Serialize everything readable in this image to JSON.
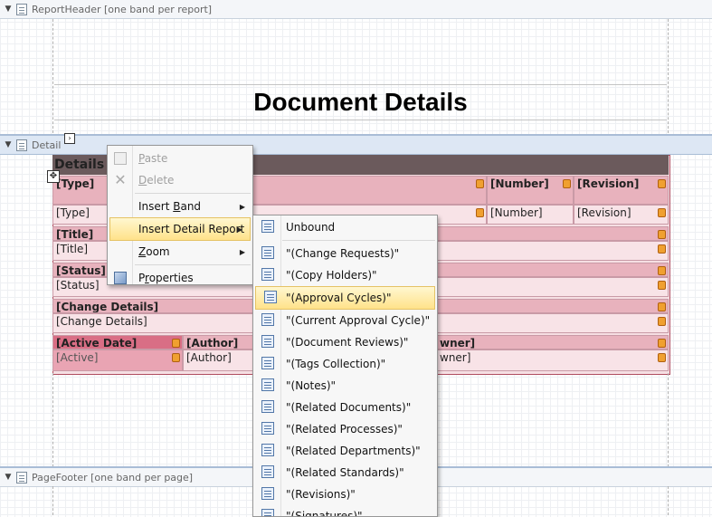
{
  "bands": {
    "report_header": "ReportHeader [one band per report]",
    "detail": "Detail",
    "page_footer": "PageFooter [one band per page]"
  },
  "title": "Document Details",
  "detail": {
    "section_title": "Details",
    "rows": [
      {
        "type_hdr": "[Type]",
        "number_hdr": "[Number]",
        "revision_hdr": "[Revision]"
      },
      {
        "type_val": "[Type]",
        "number_val": "[Number]",
        "revision_val": "[Revision]"
      }
    ],
    "title_hdr": "[Title]",
    "title_val": "[Title]",
    "status_hdr": "[Status]",
    "status_val": "[Status]",
    "change_hdr": "[Change Details]",
    "change_val": "[Change Details]",
    "active_hdr": "[Active Date]",
    "active_val": "[Active]",
    "author_hdr": "[Author]",
    "author_val": "[Author]",
    "owner_hdr": "wner]",
    "owner_val": "wner]"
  },
  "context_menu": {
    "items": [
      {
        "label": "Paste",
        "accel": "P",
        "disabled": true,
        "icon": "paste-icon"
      },
      {
        "label": "Delete",
        "accel": "D",
        "disabled": true,
        "icon": "delete-icon"
      },
      {
        "label": "Insert Band",
        "accel": "B",
        "submenu": true
      },
      {
        "label": "Insert Detail Report",
        "submenu": true,
        "highlighted": true
      },
      {
        "label": "Zoom",
        "accel": "Z",
        "submenu": true
      },
      {
        "label": "Properties",
        "accel": "r",
        "icon": "properties-icon"
      }
    ]
  },
  "submenu": {
    "items": [
      "Unbound",
      "\"(Change Requests)\"",
      "\"(Copy Holders)\"",
      "\"(Approval Cycles)\"",
      "\"(Current Approval Cycle)\"",
      "\"(Document Reviews)\"",
      "\"(Tags Collection)\"",
      "\"(Notes)\"",
      "\"(Related Documents)\"",
      "\"(Related Processes)\"",
      "\"(Related Departments)\"",
      "\"(Related Standards)\"",
      "\"(Revisions)\"",
      "\"(Signatures)\""
    ],
    "highlighted_index": 3
  },
  "colors": {
    "band_bg": "#dde7f4",
    "detail_fill": "#f6dfe3",
    "menu_highlight": "#ffe28a"
  }
}
